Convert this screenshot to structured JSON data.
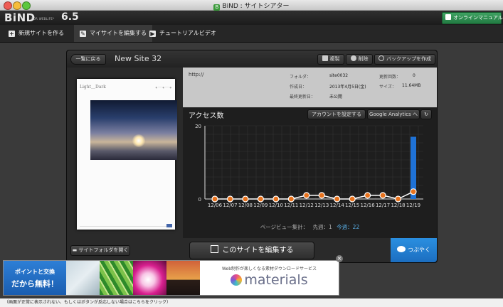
{
  "window": {
    "title": "BiND : サイトシアター"
  },
  "header": {
    "logo": "BiND",
    "logo_sub": "FOR WEBLiFE*",
    "logo_version": "6.5",
    "manual_button": "オンラインマニュアル"
  },
  "nav": {
    "tabs": [
      {
        "label": "新規サイトを作る"
      },
      {
        "label": "マイサイトを編集する"
      },
      {
        "label": "チュートリアルビデオ"
      }
    ]
  },
  "panel": {
    "back_label": "一覧に戻る",
    "site_title": "New Site 32",
    "copy_label": "複製",
    "delete_label": "削除",
    "backup_label": "バックアップを作成",
    "thumbnail": {
      "brand": "Light＿Dark"
    },
    "info": {
      "url": "http://",
      "folder_label": "フォルダ：",
      "folder_value": "site0032",
      "created_label": "作成日：",
      "created_value": "2013年4月5日(金)",
      "lastupdate_label": "最終更新日：",
      "lastupdate_value": "未公開",
      "update_count_label": "更新回数：",
      "update_count_value": "0",
      "size_label": "サイズ：",
      "size_value": "11.64MB"
    },
    "access": {
      "title": "アクセス数",
      "account_button": "アカウントを設定する",
      "ga_button": "Google Analytics へ",
      "summary_label": "ページビュー集計：",
      "last_week": "先週：1",
      "this_week": "今週：22"
    },
    "folder_button": "サイトフォルダを開く",
    "edit_button": "このサイトを編集する",
    "tweet_button": "つぶやく"
  },
  "chart_data": {
    "type": "line",
    "categories": [
      "12/06",
      "12/07",
      "12/08",
      "12/09",
      "12/10",
      "12/11",
      "12/12",
      "12/13",
      "12/14",
      "12/15",
      "12/16",
      "12/17",
      "12/18",
      "12/19"
    ],
    "y_ticks": [
      "20",
      "0"
    ],
    "ylim": [
      0,
      20
    ],
    "series": [
      {
        "type": "line",
        "values": [
          0,
          0,
          0,
          0,
          0,
          0,
          1,
          1,
          0,
          0,
          1,
          1,
          0,
          2
        ]
      },
      {
        "type": "bar",
        "values": [
          0,
          0,
          0,
          0,
          0,
          0,
          0,
          0,
          0,
          0,
          0,
          0,
          0,
          17
        ]
      }
    ],
    "colors": {
      "line": "#ffffff",
      "point": "#e8731e",
      "bar": "#1f72d6"
    },
    "grid": true
  },
  "ad": {
    "left_line1": "ポイントと交換",
    "left_line2": "だから無料！",
    "subtitle": "Web制作が楽しくなる素材ダウンロードサービス",
    "brand": "materials"
  },
  "footer": {
    "note": "（画面が正常に表示されない、もしくはボタンが反応しない場合はこちらをクリック）"
  }
}
